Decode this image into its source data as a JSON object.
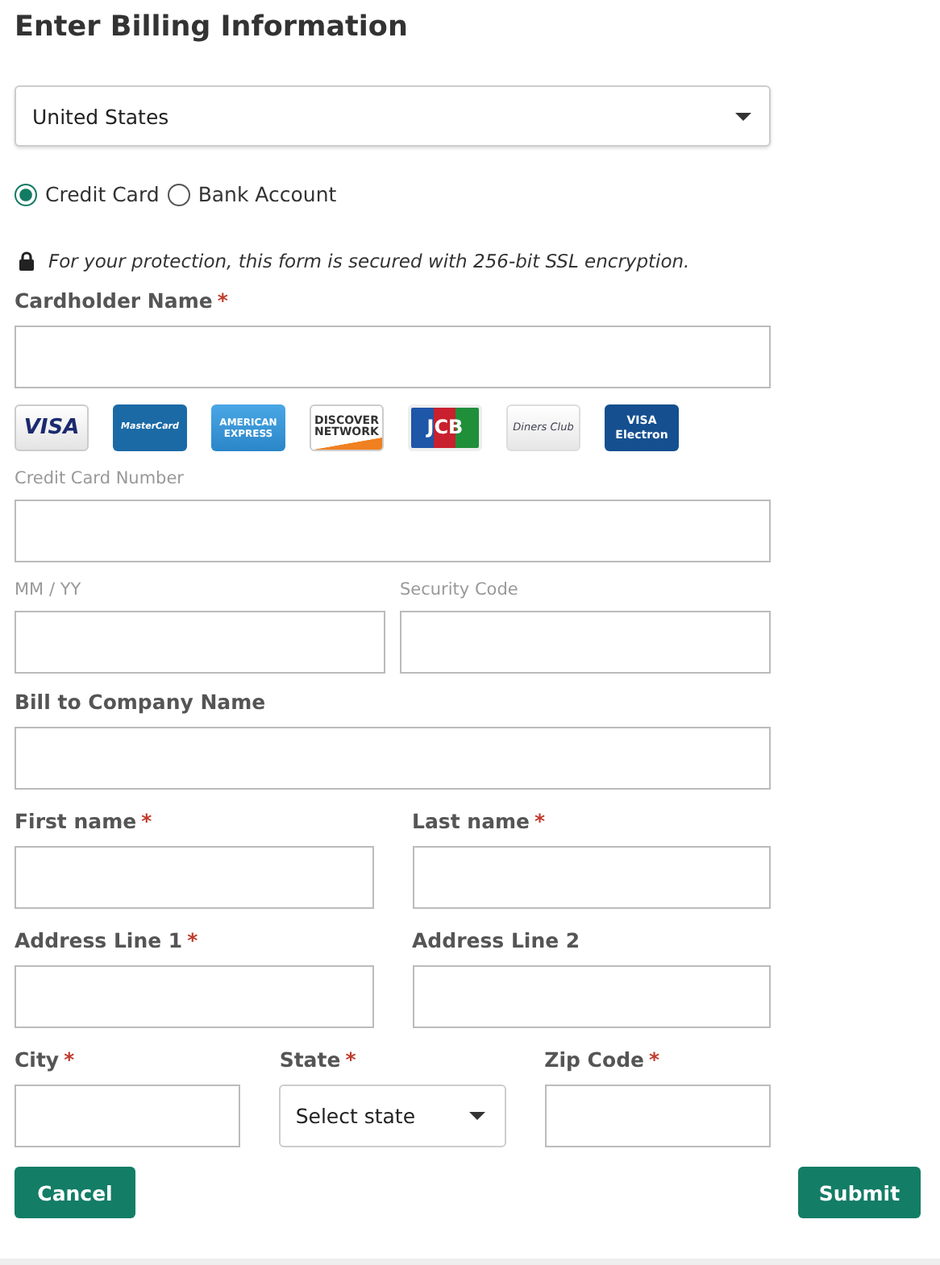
{
  "title": "Enter Billing Information",
  "country": {
    "value": "United States"
  },
  "payment_methods": [
    {
      "label": "Credit Card",
      "selected": true
    },
    {
      "label": "Bank Account",
      "selected": false
    }
  ],
  "security_note": "For your protection, this form is secured with 256-bit SSL encryption.",
  "rows": [
    {
      "kind": "fields",
      "fields": [
        {
          "label": "Cardholder Name",
          "marker": "*",
          "kind": "text"
        }
      ]
    },
    {
      "kind": "cards",
      "cards": [
        {
          "kind": "visa",
          "text": "VISA"
        },
        {
          "kind": "mastercard",
          "text": "MasterCard"
        },
        {
          "kind": "amex",
          "text": "AMERICAN\nEXPRESS"
        },
        {
          "kind": "discover",
          "text": "DISCOVER\nNETWORK"
        },
        {
          "kind": "jcb",
          "text": "JCB"
        },
        {
          "kind": "diners",
          "text": "Diners Club"
        },
        {
          "kind": "electron",
          "text": "VISA\nElectron"
        }
      ]
    },
    {
      "kind": "card_fields",
      "fields": [
        {
          "label": "Credit Card Number",
          "kind": "text"
        }
      ]
    },
    {
      "kind": "card_fields",
      "fields": [
        {
          "label": "MM / YY",
          "kind": "text"
        },
        {
          "label": "Security Code",
          "kind": "text"
        }
      ]
    },
    {
      "kind": "fields",
      "fields": [
        {
          "label": "Bill to Company Name",
          "kind": "text"
        }
      ]
    },
    {
      "kind": "fields",
      "fields": [
        {
          "label": "First name",
          "marker": "*",
          "kind": "text"
        },
        {
          "label": "Last name",
          "marker": "*",
          "kind": "text"
        }
      ]
    },
    {
      "kind": "fields",
      "fields": [
        {
          "label": "Address Line 1",
          "marker": "*",
          "kind": "text"
        },
        {
          "label": "Address Line 2",
          "kind": "text"
        }
      ]
    },
    {
      "kind": "fields",
      "fields": [
        {
          "label": "City",
          "marker": "*",
          "kind": "text"
        },
        {
          "label": "State",
          "marker": "*",
          "kind": "select",
          "value": "Select state"
        },
        {
          "label": "Zip Code",
          "marker": "*",
          "kind": "text"
        }
      ]
    }
  ],
  "buttons": [
    {
      "label": "Cancel",
      "kind": "cancel"
    },
    {
      "label": "Submit",
      "kind": "submit"
    }
  ]
}
